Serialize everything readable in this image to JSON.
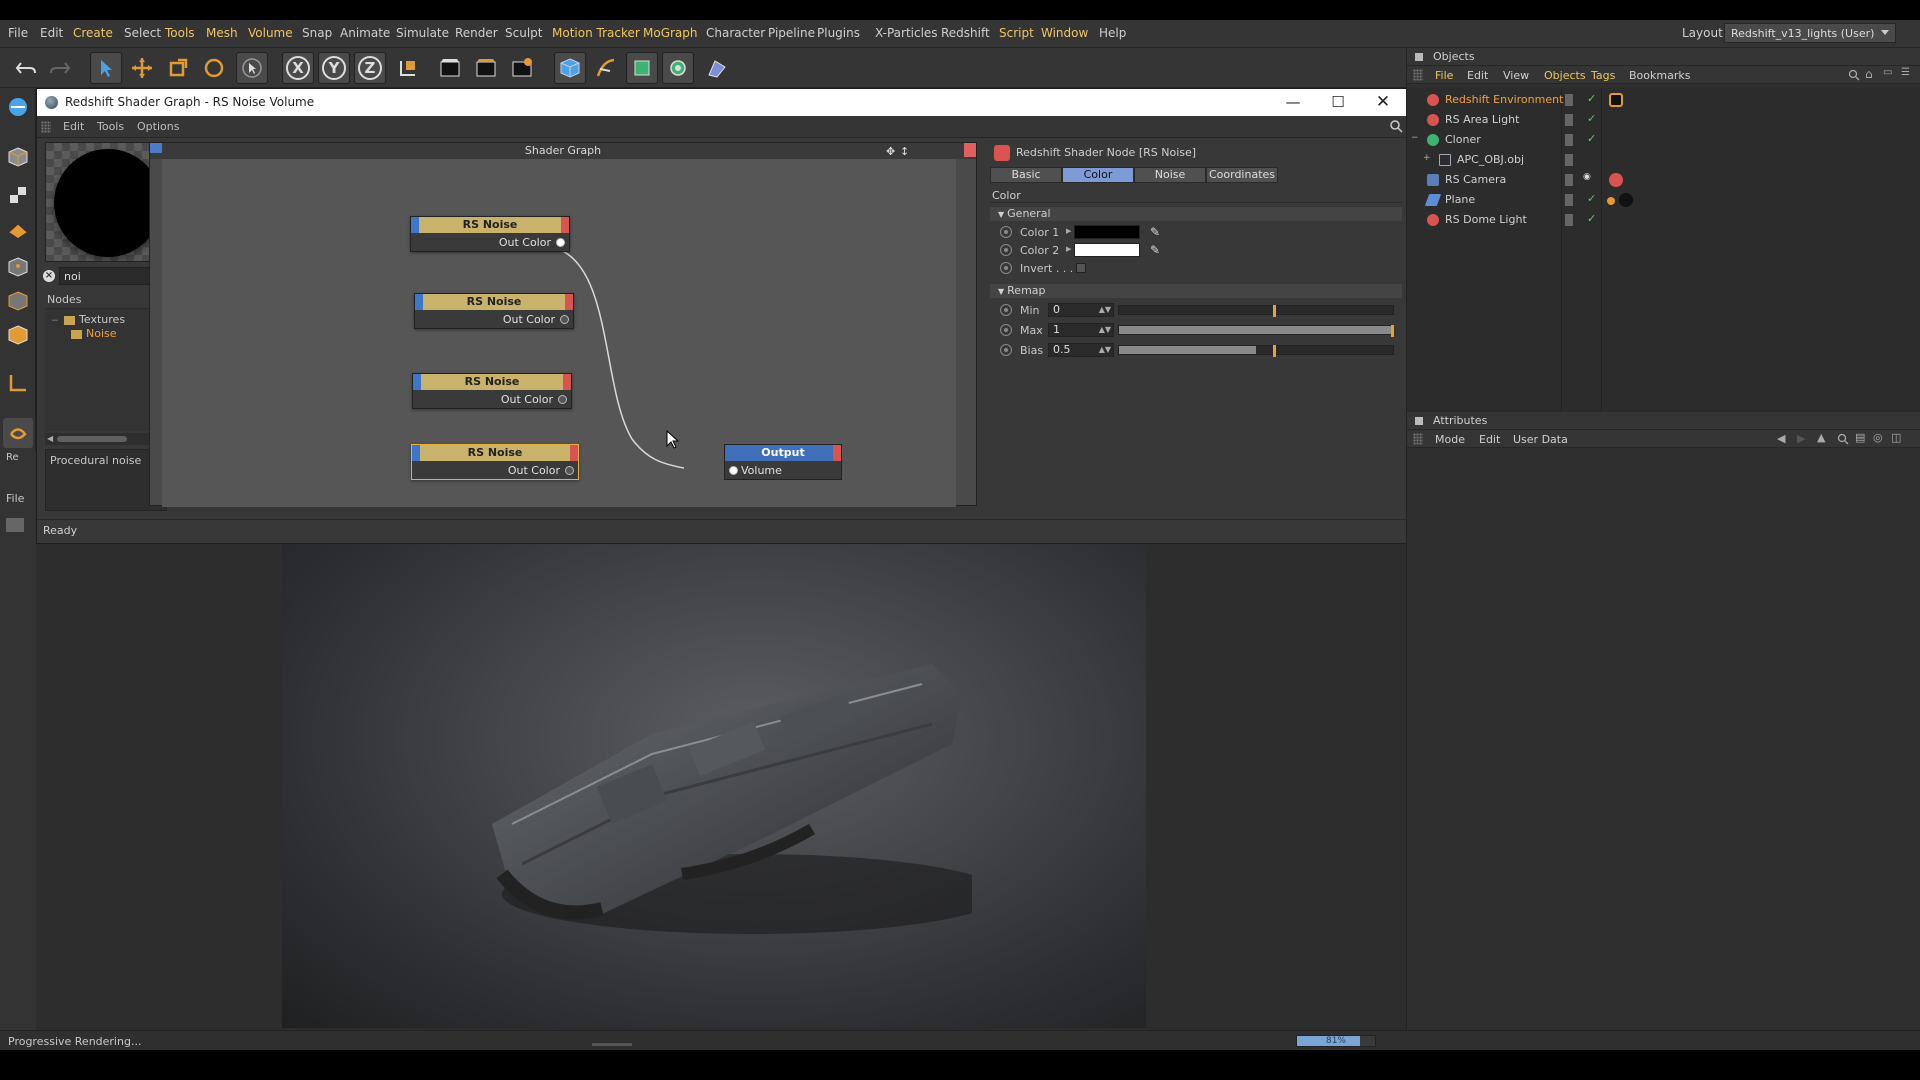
{
  "menubar": {
    "items": [
      "File",
      "Edit",
      "Create",
      "Select",
      "Tools",
      "Mesh",
      "Volume",
      "Snap",
      "Animate",
      "Simulate",
      "Render",
      "Sculpt",
      "Motion Tracker",
      "MoGraph",
      "Character",
      "Pipeline",
      "Plugins",
      "X-Particles",
      "Redshift",
      "Script",
      "Window",
      "Help"
    ],
    "layout_label": "Layout:",
    "layout_value": "Redshift_v13_lights (User)"
  },
  "toolbar": {
    "icons": [
      "undo-icon",
      "redo-icon",
      "select-arrow-icon",
      "move-icon",
      "scale-icon",
      "rotate-icon",
      "live-select-icon",
      "x-axis-icon",
      "y-axis-icon",
      "z-axis-icon",
      "coordinate-icon",
      "render-region-icon",
      "render-view-icon",
      "render-settings-icon",
      "cube-icon",
      "pen-icon",
      "subdivision-icon",
      "cloner-icon",
      "deformer-icon"
    ],
    "x_label": "X",
    "y_label": "Y",
    "z_label": "Z"
  },
  "shader_window": {
    "title": "Redshift Shader Graph - RS Noise Volume",
    "menu": [
      "Edit",
      "Tools",
      "Options"
    ],
    "search_value": "noi",
    "nodes_header": "Nodes",
    "tree": {
      "folder": "Textures",
      "item": "Noise"
    },
    "description": "Procedural noise",
    "graph_title": "Shader Graph",
    "nodes": [
      {
        "name": "RS Noise",
        "port": "Out Color"
      },
      {
        "name": "RS Noise",
        "port": "Out Color"
      },
      {
        "name": "RS Noise",
        "port": "Out Color"
      },
      {
        "name": "RS Noise",
        "port": "Out Color"
      }
    ],
    "output_node": {
      "name": "Output",
      "port": "Volume"
    },
    "status": "Ready"
  },
  "properties": {
    "header": "Redshift Shader Node [RS Noise]",
    "tabs": [
      "Basic",
      "Color",
      "Noise",
      "Coordinates"
    ],
    "active_tab": "Color",
    "section": "Color",
    "general": {
      "title": "General",
      "color1_label": "Color 1",
      "color1_value": "#000000",
      "color2_label": "Color 2",
      "color2_value": "#ffffff",
      "invert_label": "Invert . . ."
    },
    "remap": {
      "title": "Remap",
      "min_label": "Min",
      "min_value": "0",
      "max_label": "Max",
      "max_value": "1",
      "bias_label": "Bias",
      "bias_value": "0.5"
    }
  },
  "objects_panel": {
    "title": "Objects",
    "menu": [
      "File",
      "Edit",
      "View",
      "Objects",
      "Tags",
      "Bookmarks"
    ],
    "objects": [
      {
        "name": "Redshift Environment",
        "icon": "rs-environment-icon"
      },
      {
        "name": "RS Area Light",
        "icon": "rs-light-icon"
      },
      {
        "name": "Cloner",
        "icon": "cloner-icon"
      },
      {
        "name": "APC_OBJ.obj",
        "icon": "null-object-icon"
      },
      {
        "name": "RS Camera",
        "icon": "camera-icon"
      },
      {
        "name": "Plane",
        "icon": "plane-icon"
      },
      {
        "name": "RS Dome Light",
        "icon": "rs-dome-light-icon"
      }
    ]
  },
  "attributes_panel": {
    "title": "Attributes",
    "menu": [
      "Mode",
      "Edit",
      "User Data"
    ]
  },
  "left_mini": {
    "label1": "Re",
    "label2": "File"
  },
  "statusbar": {
    "text": "Progressive Rendering...",
    "progress_percent": 81,
    "progress_text": "81%"
  },
  "colors": {
    "accent_yellow": "#f0c560",
    "node_header": "#c9b26b",
    "output_header": "#3f6fb9",
    "active_tab": "#7d9bd4"
  }
}
